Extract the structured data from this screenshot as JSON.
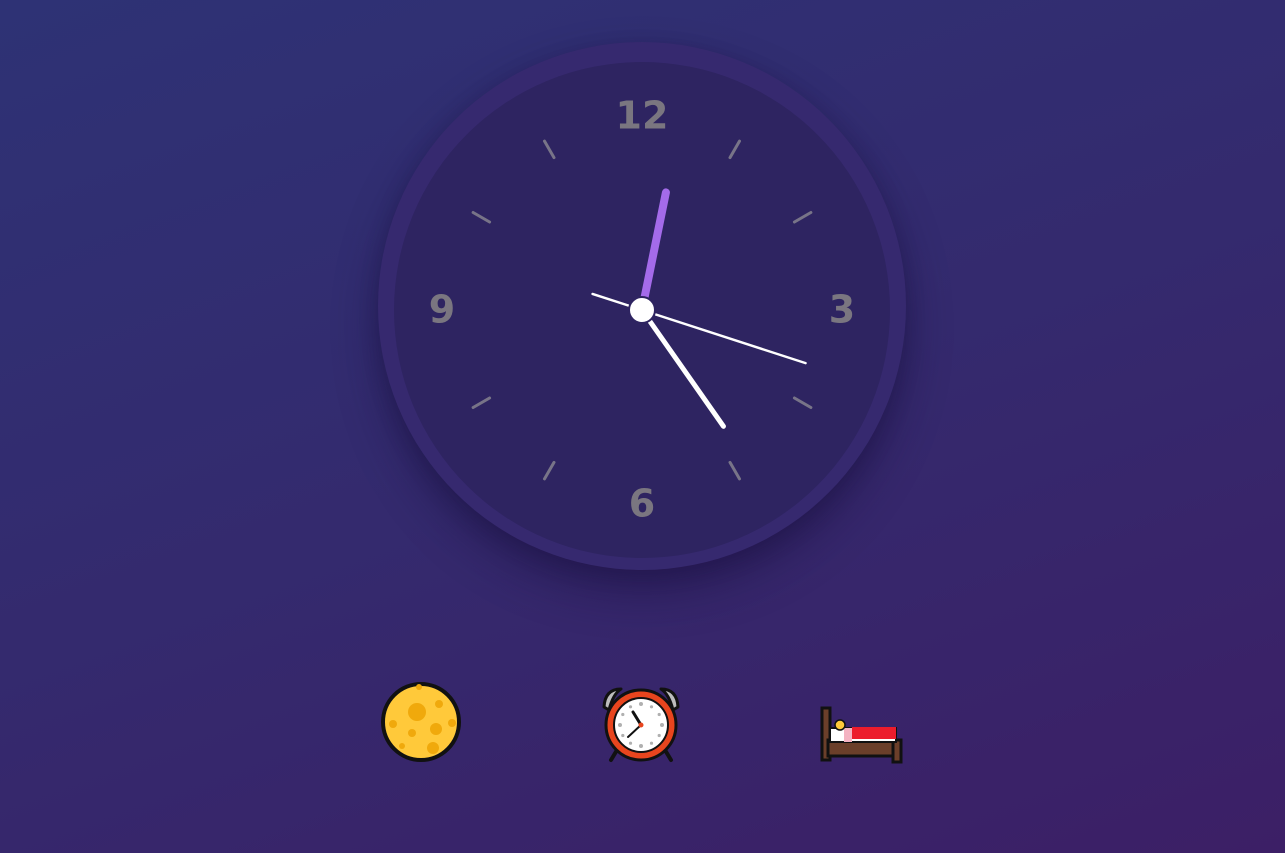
{
  "clock": {
    "numerals": [
      "12",
      "3",
      "6",
      "9"
    ],
    "time": {
      "hours": 12,
      "minutes": 23,
      "seconds": 18
    },
    "colors": {
      "hour_hand": "#a46bea",
      "minute_hand": "#ffffff",
      "second_hand": "#ffffff",
      "numerals": "#7a7680"
    }
  },
  "controls": [
    {
      "icon": "moon-icon"
    },
    {
      "icon": "alarm-clock-icon"
    },
    {
      "icon": "bed-icon"
    }
  ]
}
